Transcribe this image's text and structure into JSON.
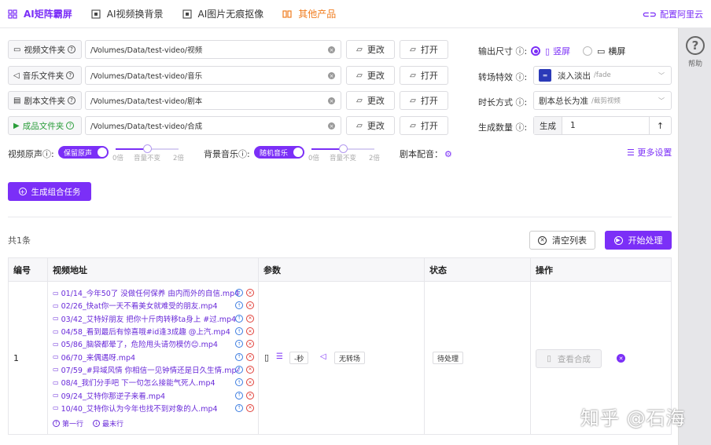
{
  "topbar": {
    "tabs": [
      {
        "label": "AI矩阵霸屏",
        "icon": "grid-icon"
      },
      {
        "label": "AI视频换背景",
        "icon": "image-frame-icon"
      },
      {
        "label": "AI图片无痕抠像",
        "icon": "image-frame-icon"
      },
      {
        "label": "其他产品",
        "icon": "products-icon"
      }
    ],
    "config_label": "配置阿里云"
  },
  "sidebar": {
    "help_label": "帮助"
  },
  "folders": [
    {
      "label": "视频文件夹",
      "path": "/Volumes/Data/test-video/视频",
      "icon": "video-icon"
    },
    {
      "label": "音乐文件夹",
      "path": "/Volumes/Data/test-video/音乐",
      "icon": "speaker-icon"
    },
    {
      "label": "剧本文件夹",
      "path": "/Volumes/Data/test-video/剧本",
      "icon": "document-icon"
    },
    {
      "label": "成品文件夹",
      "path": "/Volumes/Data/test-video/合成",
      "icon": "play-icon"
    }
  ],
  "folder_buttons": {
    "change": "更改",
    "open": "打开"
  },
  "settings": {
    "output_size_label": "输出尺寸",
    "portrait_label": "竖屏",
    "landscape_label": "横屏",
    "transition_label": "转场特效",
    "transition_value": "淡入淡出",
    "transition_sub": "/fade",
    "duration_label": "时长方式",
    "duration_value": "剧本总长为准",
    "duration_sub": "/截剪视频",
    "count_label": "生成数量",
    "count_prefix": "生成",
    "count_value": "1"
  },
  "audio": {
    "original_label": "视频原声",
    "original_toggle": "保留原声",
    "bgm_label": "背景音乐",
    "bgm_toggle": "随机音乐",
    "ticks": [
      "0倍",
      "音量不变",
      "2倍"
    ],
    "original_level": 0.5,
    "bgm_level": 0.5,
    "script_voice_label": "剧本配音：",
    "more_settings": "更多设置"
  },
  "generate_button": "生成组合任务",
  "list": {
    "count_text": "共1条",
    "clear_button": "清空列表",
    "start_button": "开始处理"
  },
  "table": {
    "headers": [
      "编号",
      "视频地址",
      "参数",
      "状态",
      "操作"
    ],
    "row": {
      "index": "1",
      "videos": [
        "01/14_今年50了 没做任何保养 由内而外的自信.mp4",
        "02/26_快at你一天不看美女就难受的朋友.mp4",
        "03/42_艾特好朋友 把你十斤肉转移ta身上 #过.mp4",
        "04/58_看到最后有惊喜哦#id逢3成趣 @上汽.mp4",
        "05/86_脑袋都晕了，危险甩头请勿模仿😊.mp4",
        "06/70_来偶遇呀.mp4",
        "07/59_#异域风情 你相信一见钟情还是日久生情.mp4",
        "08/4_我们分手吧 下一句怎么接能气死人.mp4",
        "09/24_艾特你那逆子来看.mp4",
        "10/40_艾特你认为今年也找不到对象的人.mp4"
      ],
      "first_row_link": "第一行",
      "last_row_link": "最末行",
      "param_seconds": "-秒",
      "param_transition": "无转场",
      "status": "待处理",
      "view_button": "查看合成"
    }
  },
  "watermark": "知乎 @石海",
  "colors": {
    "accent": "#7b2ff7",
    "orange": "#f07c1e",
    "green": "#2a9d3a"
  }
}
